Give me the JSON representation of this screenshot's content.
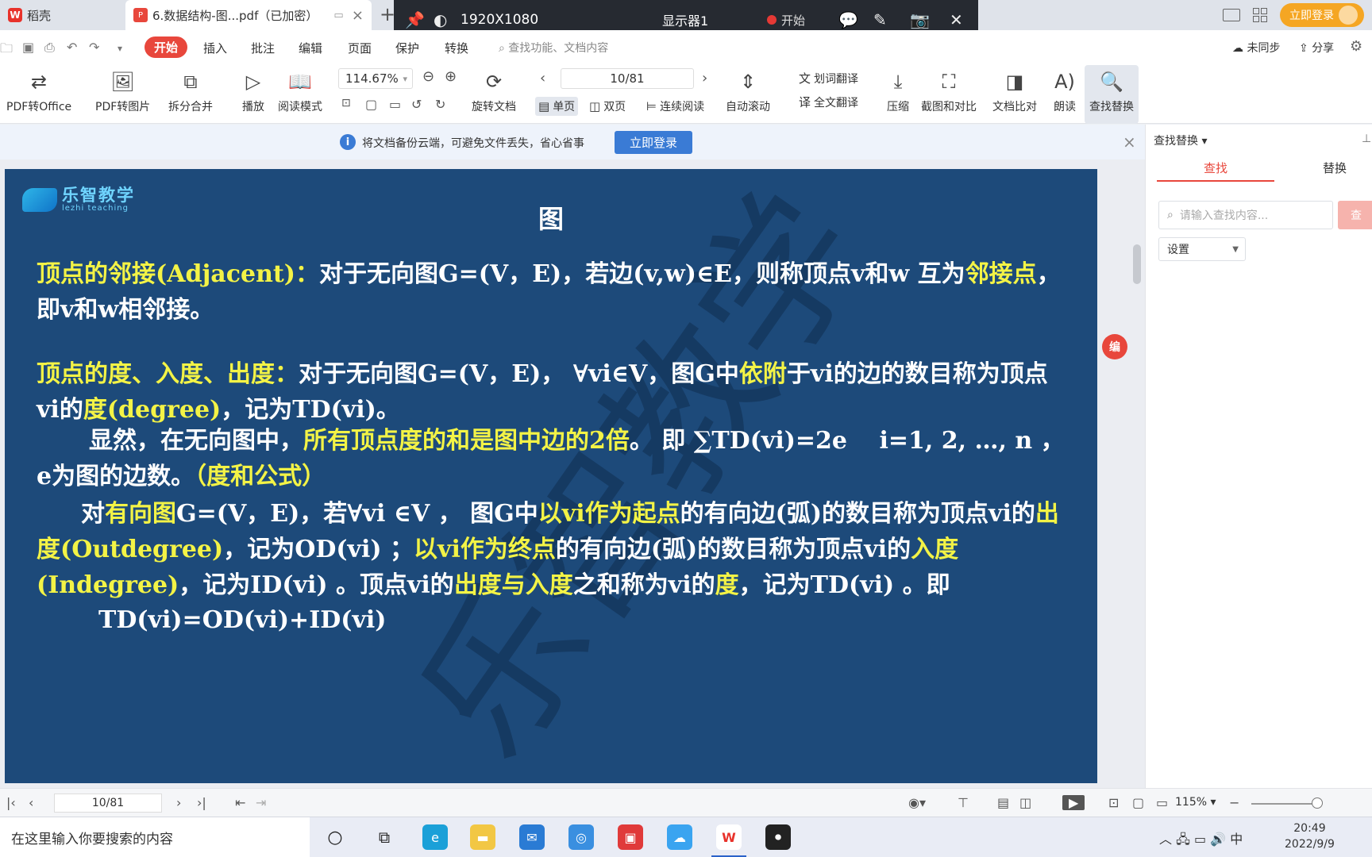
{
  "titlebar": {
    "home_tab": "稻壳",
    "doc_tab": "6.数据结构-图...pdf（已加密）",
    "login": "立即登录"
  },
  "recorder": {
    "resolution": "1920X1080",
    "monitor": "显示器1",
    "start": "开始"
  },
  "menu": {
    "items": [
      "开始",
      "插入",
      "批注",
      "编辑",
      "页面",
      "保护",
      "转换"
    ],
    "search_placeholder": "查找功能、文档内容",
    "sync": "未同步",
    "share": "分享"
  },
  "toolbar": {
    "pdf_to_office": "PDF转Office",
    "pdf_to_image": "PDF转图片",
    "split_merge": "拆分合并",
    "play": "播放",
    "reading_mode": "阅读模式",
    "zoom": "114.67%",
    "page": "10/81",
    "rotate": "旋转文档",
    "single_page": "单页",
    "double_page": "双页",
    "continuous": "连续阅读",
    "auto_scroll": "自动滚动",
    "word_translate": "划词翻译",
    "full_translate": "全文翻译",
    "compress": "压缩",
    "screenshot_compare": "截图和对比",
    "doc_compare": "文档比对",
    "read_aloud": "朗读",
    "find_replace": "查找替换"
  },
  "notice": {
    "text": "将文档备份云端，可避免文件丢失，省心省事",
    "button": "立即登录"
  },
  "slide": {
    "logo_cn": "乐智教学",
    "logo_en": "lezhi teaching",
    "title": "图",
    "watermark": "乐智教学",
    "p1_y1": "顶点的邻接(Adjacent)：",
    "p1_w1": "对于无向图G=(V，E)，若边(v,w)∈E，则称顶点v和w 互为",
    "p1_y2": "邻接点",
    "p1_w2": "，即v和w相邻接。",
    "p2_y1": "顶点的度、入度、出度：",
    "p2_w1": "对于无向图G=(V，E)， ∀vi∈V，图G中",
    "p2_y2": "依附",
    "p2_w2": "于vi的边的数目称为顶点vi的",
    "p2_y3": "度(degree)",
    "p2_w3": "，记为TD(vi)。",
    "p3_w1": "显然，在无向图中，",
    "p3_y1": "所有顶点度的和是图中边的2倍",
    "p3_w2": "。 即 ∑TD(vi)=2e　 i=1, 2, …, n ， e为图的边数。",
    "p3_y2": "（度和公式）",
    "p4_w1": "对",
    "p4_y1": "有向图",
    "p4_w2": "G=(V，E)，若∀vi ∈V ， 图G中",
    "p4_y2": "以vi作为起点",
    "p4_w3": "的有向边(弧)的数目称为顶点vi的",
    "p4_y3": "出度(Outdegree)",
    "p4_w4": "，记为OD(vi) ；",
    "p4_y4": "以vi作为终点",
    "p4_w5": "的有向边(弧)的数目称为顶点vi的",
    "p4_y5": "入度(Indegree)",
    "p4_w6": "，记为ID(vi) 。顶点vi的",
    "p4_y6": "出度与入度",
    "p4_w7": "之和称为vi的",
    "p4_y7": "度",
    "p4_w8": "，记为TD(vi) 。即",
    "p5": "TD(vi)=OD(vi)+ID(vi)"
  },
  "right_panel": {
    "title": "查找替换",
    "tab_find": "查找",
    "tab_replace": "替换",
    "search_placeholder": "请输入查找内容...",
    "search_button": "查",
    "settings": "设置"
  },
  "statusbar": {
    "page": "10/81",
    "zoom": "115%"
  },
  "taskbar": {
    "search": "在这里输入你要搜索的内容",
    "ime": "中",
    "time": "20:49",
    "date": "2022/9/9"
  }
}
